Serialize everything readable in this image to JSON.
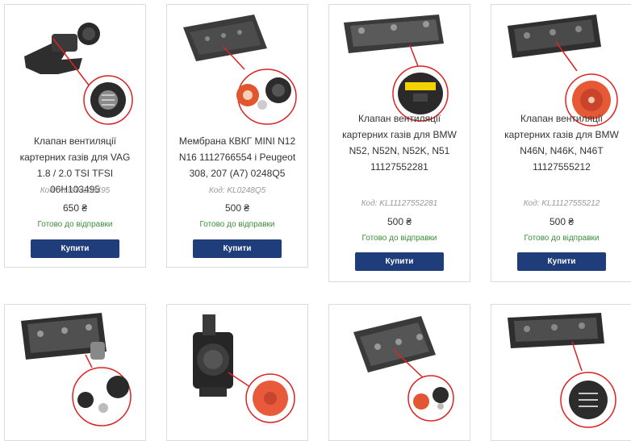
{
  "products": [
    {
      "title_lines": [
        "Клапан вентиляції",
        "картерних газів для VAG",
        "1.8 / 2.0 TSI TFSI 06H103495"
      ],
      "code": "Код: KL06H103495",
      "price": "650 ₴",
      "availability": "Готово до відправки",
      "buy_label": "Купити"
    },
    {
      "title_lines": [
        "Мембрана КВКГ MINI N12",
        "N16 1112766554 і Peugeot",
        "308, 207 (A7) 0248Q5"
      ],
      "code": "Код: KL0248Q5",
      "price": "500 ₴",
      "availability": "Готово до відправки",
      "buy_label": "Купити"
    },
    {
      "title_lines": [
        "Клапан вентиляції",
        "картерних газів для BMW",
        "N52, N52N, N52K, N51",
        "11127552281"
      ],
      "code": "Код: KL11127552281",
      "price": "500 ₴",
      "availability": "Готово до відправки",
      "buy_label": "Купити"
    },
    {
      "title_lines": [
        "Клапан вентиляції",
        "картерних газів для BMW",
        "N46N, N46K, N46T",
        "11127555212"
      ],
      "code": "Код: KL11127555212",
      "price": "500 ₴",
      "availability": "Готово до відправки",
      "buy_label": "Купити"
    }
  ]
}
